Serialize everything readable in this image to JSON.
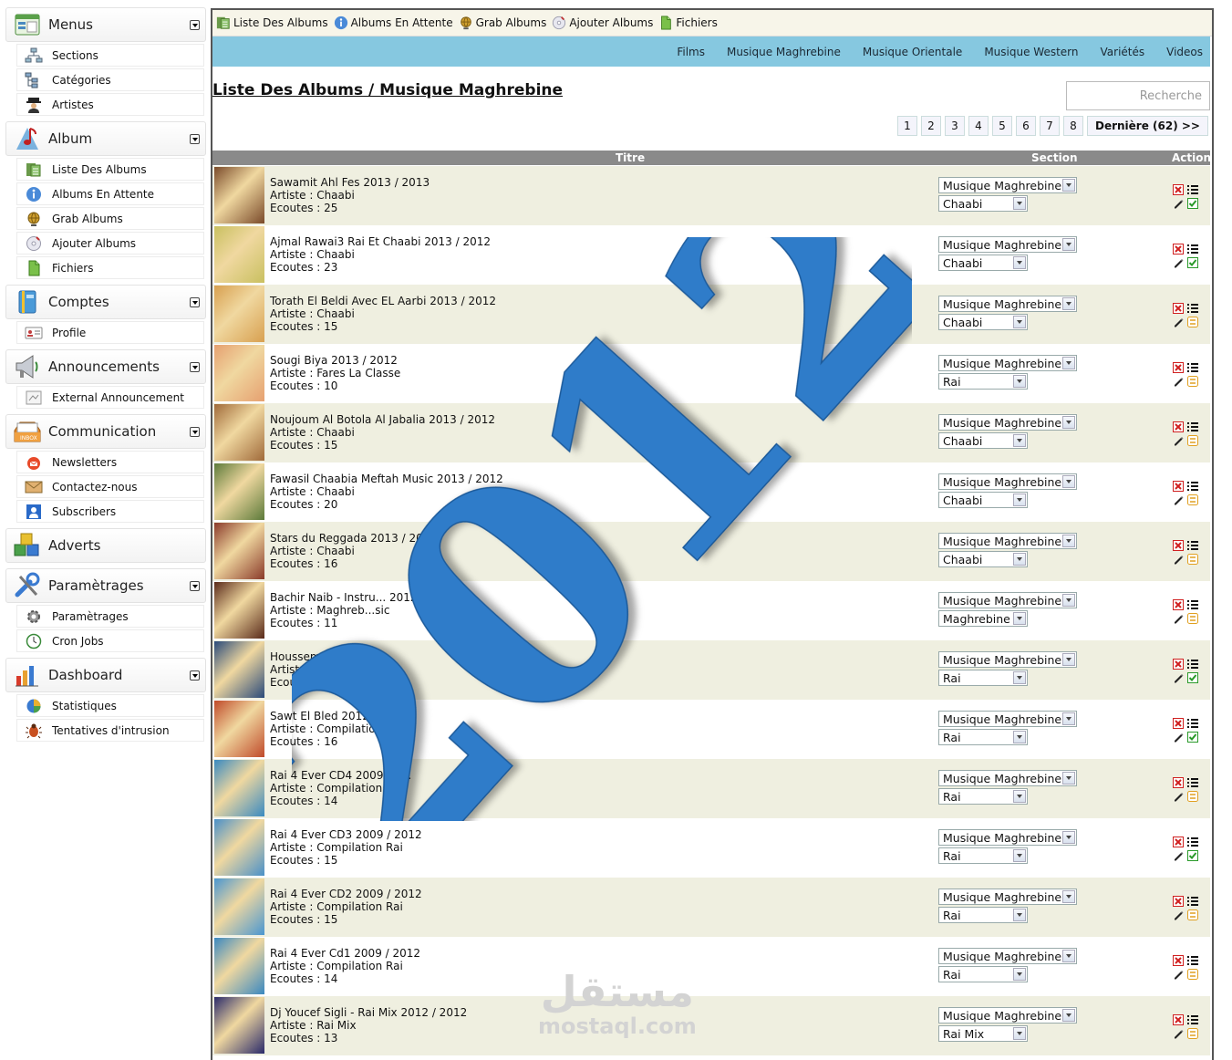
{
  "sidebar": {
    "sections": [
      {
        "label": "Menus",
        "icon": "window-icon",
        "items": [
          {
            "label": "Sections",
            "icon": "sitemap-icon"
          },
          {
            "label": "Catégories",
            "icon": "tree-icon"
          },
          {
            "label": "Artistes",
            "icon": "user-hat-icon"
          }
        ]
      },
      {
        "label": "Album",
        "icon": "music-note-icon",
        "items": [
          {
            "label": "Liste Des Albums",
            "icon": "album-list-icon"
          },
          {
            "label": "Albums En Attente",
            "icon": "info-icon"
          },
          {
            "label": "Grab Albums",
            "icon": "globe-icon"
          },
          {
            "label": "Ajouter Albums",
            "icon": "cd-add-icon"
          },
          {
            "label": "Fichiers",
            "icon": "file-icon"
          }
        ]
      },
      {
        "label": "Comptes",
        "icon": "book-icon",
        "items": [
          {
            "label": "Profile",
            "icon": "id-card-icon"
          }
        ]
      },
      {
        "label": "Announcements",
        "icon": "megaphone-icon",
        "items": [
          {
            "label": "External Announcement",
            "icon": "announcement-icon"
          }
        ]
      },
      {
        "label": "Communication",
        "icon": "inbox-icon",
        "items": [
          {
            "label": "Newsletters",
            "icon": "newsletter-icon"
          },
          {
            "label": "Contactez-nous",
            "icon": "mail-icon"
          },
          {
            "label": "Subscribers",
            "icon": "subscriber-icon"
          }
        ]
      },
      {
        "label": "Adverts",
        "icon": "cubes-icon",
        "items": []
      },
      {
        "label": "Paramètrages",
        "icon": "tools-icon",
        "items": [
          {
            "label": "Paramètrages",
            "icon": "gear-icon"
          },
          {
            "label": "Cron Jobs",
            "icon": "clock-icon"
          }
        ]
      },
      {
        "label": "Dashboard",
        "icon": "bar-chart-icon",
        "items": [
          {
            "label": "Statistiques",
            "icon": "pie-chart-icon"
          },
          {
            "label": "Tentatives d'intrusion",
            "icon": "bug-icon"
          }
        ]
      }
    ]
  },
  "toolbar": {
    "items": [
      {
        "label": "Liste Des Albums",
        "icon": "album-list-icon"
      },
      {
        "label": "Albums En Attente",
        "icon": "info-icon"
      },
      {
        "label": "Grab Albums",
        "icon": "globe-icon"
      },
      {
        "label": "Ajouter Albums",
        "icon": "cd-add-icon"
      },
      {
        "label": "Fichiers",
        "icon": "file-icon"
      }
    ]
  },
  "category_nav": [
    "Films",
    "Musique Maghrebine",
    "Musique Orientale",
    "Musique Western",
    "Variétés",
    "Videos"
  ],
  "page_title": "Liste Des Albums / Musique Maghrebine",
  "search": {
    "placeholder": "Recherche"
  },
  "pagination": {
    "pages": [
      "1",
      "2",
      "3",
      "4",
      "5",
      "6",
      "7",
      "8"
    ],
    "last": "Dernière (62) >>"
  },
  "table": {
    "headers": {
      "title": "Titre",
      "section": "Section",
      "action": "Action"
    },
    "rows": [
      {
        "title": "Sawamit Ahl Fes 2013 / 2013",
        "artist": "Artiste : Chaabi",
        "plays": "Ecoutes : 25",
        "section": "Musique Maghrebine",
        "category": "Chaabi",
        "status": "active",
        "color": "#7a4a2a"
      },
      {
        "title": "Ajmal Rawai3 Rai Et Chaabi 2013 / 2012",
        "artist": "Artiste : Chaabi",
        "plays": "Ecoutes : 23",
        "section": "Musique Maghrebine",
        "category": "Chaabi",
        "status": "active",
        "color": "#c9c060"
      },
      {
        "title": "Torath El Beldi Avec EL Aarbi 2013 / 2012",
        "artist": "Artiste : Chaabi",
        "plays": "Ecoutes : 15",
        "section": "Musique Maghrebine",
        "category": "Chaabi",
        "status": "pending",
        "color": "#d8a050"
      },
      {
        "title": "Sougi Biya 2013 / 2012",
        "artist": "Artiste : Fares La Classe",
        "plays": "Ecoutes : 10",
        "section": "Musique Maghrebine",
        "category": "Rai",
        "status": "pending",
        "color": "#e6a070"
      },
      {
        "title": "Noujoum Al Botola Al Jabalia 2013 / 2012",
        "artist": "Artiste : Chaabi",
        "plays": "Ecoutes : 15",
        "section": "Musique Maghrebine",
        "category": "Chaabi",
        "status": "pending",
        "color": "#a06a3a"
      },
      {
        "title": "Fawasil Chaabia Meftah Music 2013 / 2012",
        "artist": "Artiste : Chaabi",
        "plays": "Ecoutes : 20",
        "section": "Musique Maghrebine",
        "category": "Chaabi",
        "status": "pending",
        "color": "#5c7a3a"
      },
      {
        "title": "Stars du Reggada 2013 / 2012",
        "artist": "Artiste : Chaabi",
        "plays": "Ecoutes : 16",
        "section": "Musique Maghrebine",
        "category": "Chaabi",
        "status": "pending",
        "color": "#8a3a2a"
      },
      {
        "title": "Bachir Naib - Instru... 2012",
        "artist": "Artiste : Maghreb...sic",
        "plays": "Ecoutes : 11",
        "section": "Musique Maghrebine",
        "category": "Maghrebine",
        "status": "pending",
        "color": "#5a2a1a"
      },
      {
        "title": "Houssem...ch 20...2",
        "artist": "Artiste : C...",
        "plays": "Ecoutes : ...",
        "section": "Musique Maghrebine",
        "category": "Rai",
        "status": "active",
        "color": "#2a4a7a"
      },
      {
        "title": "Sawt El Bled 2012 / 2...",
        "artist": "Artiste : Compilation R...",
        "plays": "Ecoutes : 16",
        "section": "Musique Maghrebine",
        "category": "Rai",
        "status": "active",
        "color": "#c04a2a"
      },
      {
        "title": "Rai 4 Ever CD4 2009 / 2...",
        "artist": "Artiste : Compilation Rai",
        "plays": "Ecoutes : 14",
        "section": "Musique Maghrebine",
        "category": "Rai",
        "status": "pending",
        "color": "#3a8ac0"
      },
      {
        "title": "Rai 4 Ever CD3 2009 / 2012",
        "artist": "Artiste : Compilation Rai",
        "plays": "Ecoutes : 15",
        "section": "Musique Maghrebine",
        "category": "Rai",
        "status": "active",
        "color": "#4a90c8"
      },
      {
        "title": "Rai 4 Ever CD2 2009 / 2012",
        "artist": "Artiste : Compilation Rai",
        "plays": "Ecoutes : 15",
        "section": "Musique Maghrebine",
        "category": "Rai",
        "status": "pending",
        "color": "#4a96d0"
      },
      {
        "title": "Rai 4 Ever Cd1 2009 / 2012",
        "artist": "Artiste : Compilation Rai",
        "plays": "Ecoutes : 14",
        "section": "Musique Maghrebine",
        "category": "Rai",
        "status": "pending",
        "color": "#3a88c0"
      },
      {
        "title": "Dj Youcef Sigli - Rai Mix 2012 / 2012",
        "artist": "Artiste : Rai Mix",
        "plays": "Ecoutes : 13",
        "section": "Musique Maghrebine",
        "category": "Rai Mix",
        "status": "pending",
        "color": "#2a2a6a"
      }
    ]
  },
  "watermark": {
    "year": "2012",
    "brand_ar": "مستقل",
    "brand_en": "mostaql.com",
    "year_color": "#2f7cc9"
  }
}
